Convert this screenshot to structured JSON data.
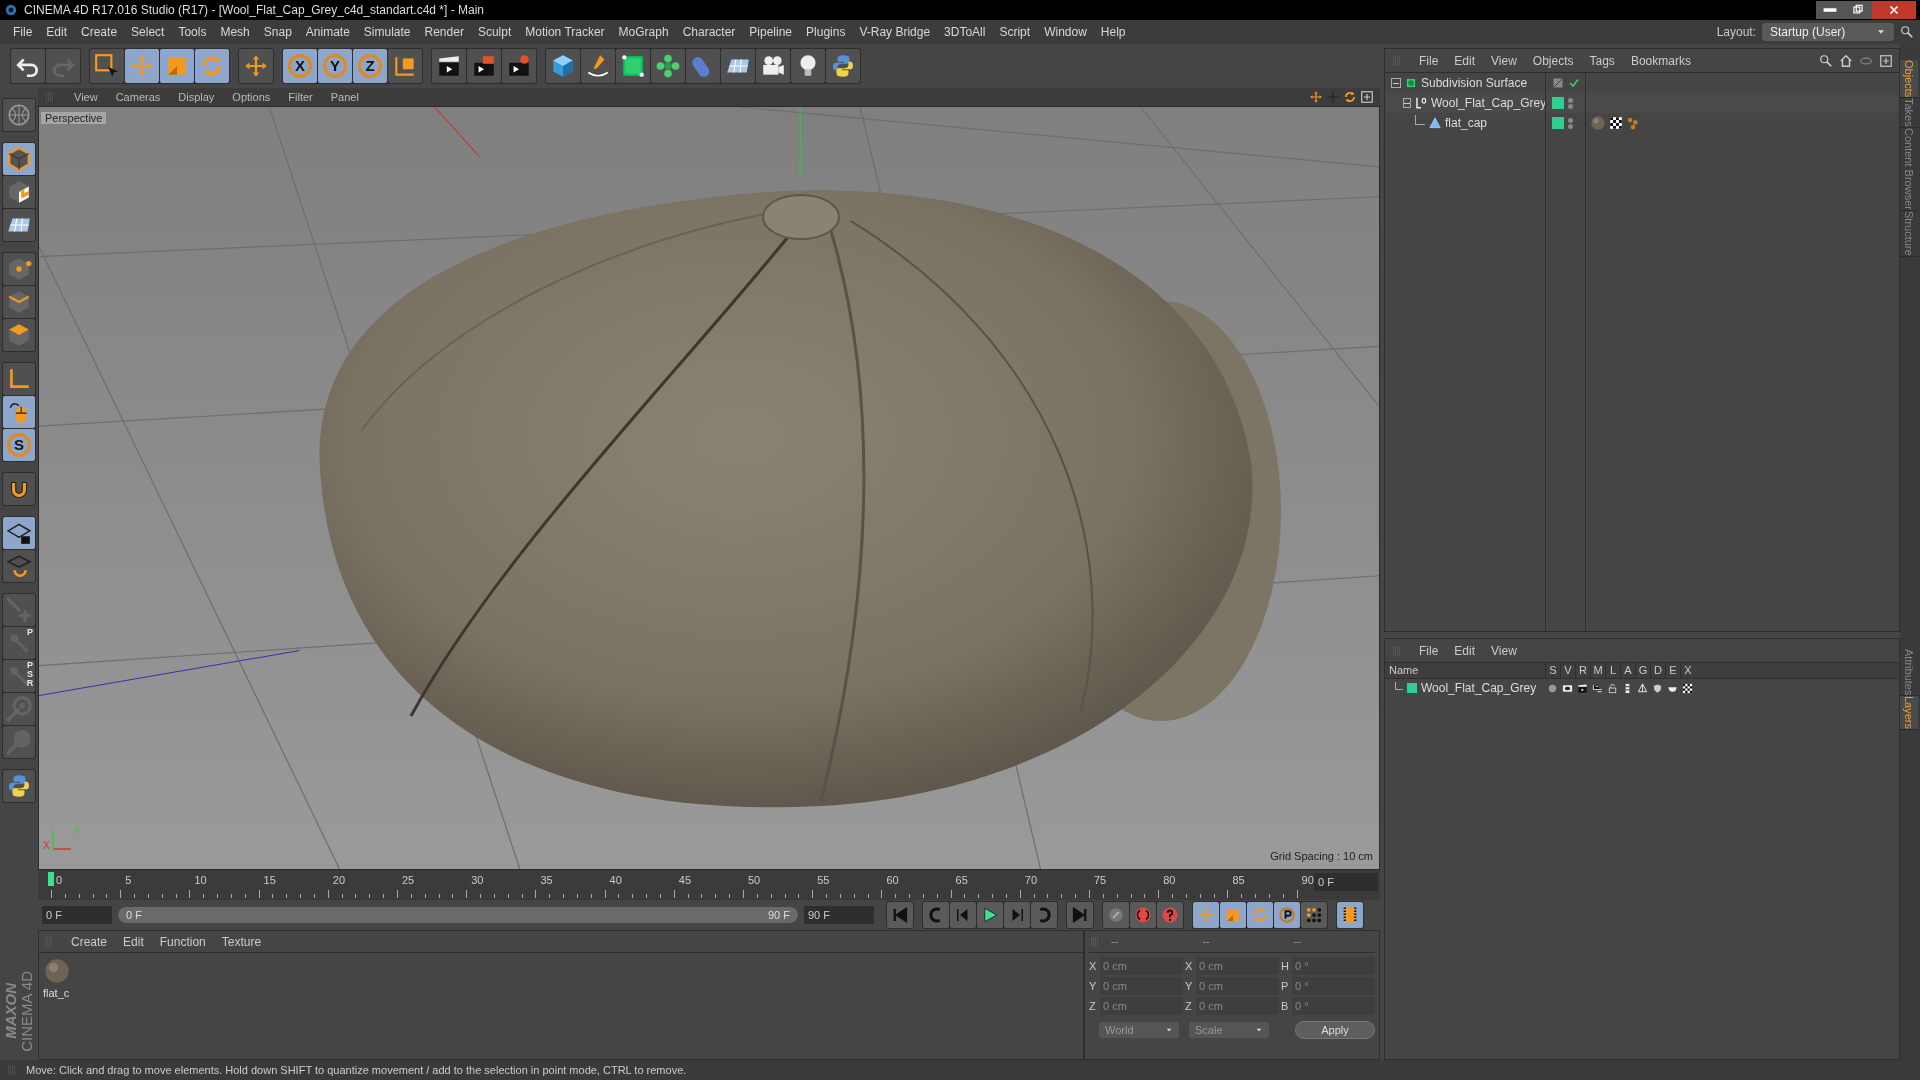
{
  "window": {
    "title": "CINEMA 4D R17.016 Studio (R17) - [Wool_Flat_Cap_Grey_c4d_standart.c4d *] - Main"
  },
  "menu": [
    "File",
    "Edit",
    "Create",
    "Select",
    "Tools",
    "Mesh",
    "Snap",
    "Animate",
    "Simulate",
    "Render",
    "Sculpt",
    "Motion Tracker",
    "MoGraph",
    "Character",
    "Pipeline",
    "Plugins",
    "V-Ray Bridge",
    "3DToAll",
    "Script",
    "Window",
    "Help"
  ],
  "layout": {
    "label": "Layout:",
    "value": "Startup (User)"
  },
  "toolbar": [
    {
      "kind": "curved-arrow",
      "selected": false
    },
    {
      "kind": "redo-arrow",
      "selected": false
    },
    {
      "kind": "square-cursor",
      "selected": false
    },
    {
      "kind": "four-way-arrow",
      "selected": true
    },
    {
      "kind": "square",
      "selected": true
    },
    {
      "kind": "circular-arrows",
      "selected": true
    },
    {
      "kind": "four-way-arrow",
      "selected": false
    },
    {
      "kind": "axis-letter",
      "label": "X",
      "selected": true
    },
    {
      "kind": "axis-letter",
      "label": "Y",
      "selected": true
    },
    {
      "kind": "axis-letter",
      "label": "Z",
      "selected": true
    },
    {
      "kind": "axis-corner-cube",
      "selected": false
    },
    {
      "kind": "clapperboard",
      "selected": false
    },
    {
      "kind": "clapperboard-play",
      "selected": false
    },
    {
      "kind": "clapperboard-gear",
      "selected": false
    },
    {
      "kind": "cube",
      "selected": false
    },
    {
      "kind": "pen-curve",
      "selected": false
    },
    {
      "kind": "cube-frame",
      "selected": false
    },
    {
      "kind": "sphere-cluster",
      "selected": false
    },
    {
      "kind": "capsule",
      "selected": false
    },
    {
      "kind": "grid-plane",
      "selected": false
    },
    {
      "kind": "film-camera",
      "selected": false
    },
    {
      "kind": "light-bulb",
      "selected": false
    },
    {
      "kind": "python-logo",
      "selected": false
    }
  ],
  "left_tools": [
    {
      "kind": "globe-grid",
      "selected": false,
      "disabled": false
    },
    {
      "kind": "cube-outline",
      "selected": true,
      "disabled": false
    },
    {
      "kind": "checker-cube",
      "selected": false,
      "disabled": false
    },
    {
      "kind": "grid-plane",
      "selected": false,
      "disabled": false
    },
    {
      "kind": "cube-points",
      "selected": false,
      "disabled": false
    },
    {
      "kind": "cube-edges",
      "selected": false,
      "disabled": false
    },
    {
      "kind": "cube-faces",
      "selected": false,
      "disabled": false
    },
    {
      "kind": "axis-corner",
      "selected": false,
      "disabled": false
    },
    {
      "kind": "mouse",
      "selected": true,
      "disabled": false
    },
    {
      "kind": "letter-circle",
      "label": "S",
      "selected": true,
      "disabled": false
    },
    {
      "kind": "magnet",
      "selected": false,
      "disabled": false
    },
    {
      "kind": "grid-lock",
      "selected": true,
      "disabled": false
    },
    {
      "kind": "grid-rotate",
      "selected": false,
      "disabled": false
    },
    {
      "kind": "pin-plus",
      "selected": false,
      "disabled": true
    },
    {
      "kind": "pin-letter",
      "label": "P",
      "selected": false,
      "disabled": true
    },
    {
      "kind": "pin-letter",
      "label": "PSR",
      "selected": false,
      "disabled": true
    },
    {
      "kind": "pin-target",
      "selected": false,
      "disabled": true
    },
    {
      "kind": "pin-sphere",
      "selected": false,
      "disabled": true
    },
    {
      "kind": "python-logo",
      "selected": false,
      "disabled": false
    }
  ],
  "logo": {
    "brand": "MAXON",
    "product": "CINEMA 4D"
  },
  "viewport": {
    "menu": [
      "View",
      "Cameras",
      "Display",
      "Options",
      "Filter",
      "Panel"
    ],
    "camera": "Perspective",
    "grid_spacing": "Grid Spacing : 10 cm",
    "axis_labels": [
      "X",
      "Y"
    ]
  },
  "objects": {
    "menu": [
      "File",
      "Edit",
      "View",
      "Objects",
      "Tags",
      "Bookmarks"
    ],
    "tree": [
      {
        "name": "Subdivision Surface",
        "kind": "subdivision",
        "expanded": true,
        "children": [
          {
            "name": "Wool_Flat_Cap_Grey",
            "kind": "null",
            "expanded": true,
            "children": [
              {
                "name": "flat_cap",
                "kind": "polygon"
              }
            ]
          }
        ]
      }
    ]
  },
  "side_tabs_top": [
    {
      "label": "Objects",
      "selected": true
    },
    {
      "label": "Takes",
      "selected": false
    },
    {
      "label": "Content Browser",
      "selected": false
    },
    {
      "label": "Structure",
      "selected": false
    }
  ],
  "side_tabs_bottom": [
    {
      "label": "Attributes",
      "selected": false
    },
    {
      "label": "Layers",
      "selected": true
    }
  ],
  "layers": {
    "menu": [
      "File",
      "Edit",
      "View"
    ],
    "columns": [
      "Name",
      "S",
      "V",
      "R",
      "M",
      "L",
      "A",
      "G",
      "D",
      "E",
      "X"
    ],
    "rows": [
      {
        "name": "Wool_Flat_Cap_Grey",
        "color": "#2fd08f"
      }
    ]
  },
  "timeline": {
    "ticks": [
      "0",
      "5",
      "10",
      "15",
      "20",
      "25",
      "30",
      "35",
      "40",
      "45",
      "50",
      "55",
      "60",
      "65",
      "70",
      "75",
      "80",
      "85",
      "90"
    ],
    "current": "0 F",
    "start": "0 F",
    "slider": {
      "start": "0 F",
      "end": "90 F",
      "level": 1
    },
    "end": "90 F"
  },
  "materials": {
    "menu": [
      "Create",
      "Edit",
      "Function",
      "Texture"
    ],
    "items": [
      {
        "name": "flat_c"
      }
    ]
  },
  "coordinates": {
    "headers": [
      "--",
      "--",
      "--"
    ],
    "columns": [
      [
        {
          "label": "X",
          "value": "0 cm"
        },
        {
          "label": "Y",
          "value": "0 cm"
        },
        {
          "label": "Z",
          "value": "0 cm"
        }
      ],
      [
        {
          "label": "X",
          "value": "0 cm"
        },
        {
          "label": "Y",
          "value": "0 cm"
        },
        {
          "label": "Z",
          "value": "0 cm"
        }
      ],
      [
        {
          "label": "H",
          "value": "0 °"
        },
        {
          "label": "P",
          "value": "0 °"
        },
        {
          "label": "B",
          "value": "0 °"
        }
      ]
    ],
    "mode": "World",
    "size_mode": "Scale",
    "apply": "Apply"
  },
  "status": "Move: Click and drag to move elements. Hold down SHIFT to quantize movement / add to the selection in point mode, CTRL to remove."
}
